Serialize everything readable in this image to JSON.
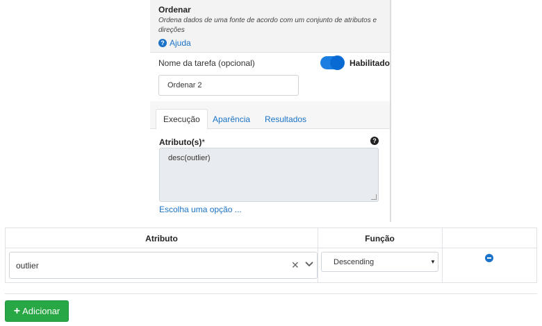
{
  "operation": {
    "title": "Ordenar",
    "description": "Ordena dados de uma fonte de acordo com um conjunto de atributos e direções",
    "help_label": "Ajuda",
    "help_icon": "?"
  },
  "task": {
    "label": "Nome da tarefa (opcional)",
    "value": "Ordenar 2",
    "toggle_label": "Habilitado",
    "toggle_on": true
  },
  "tabs": [
    {
      "label": "Execução",
      "active": true
    },
    {
      "label": "Aparência",
      "active": false
    },
    {
      "label": "Resultados",
      "active": false
    }
  ],
  "attributes_field": {
    "label": "Atributo(s)",
    "required_mark": "*",
    "info_icon": "?",
    "value": "desc(outlier)",
    "choose_link": "Escolha uma opção ..."
  },
  "grid": {
    "headers": {
      "attribute": "Atributo",
      "function": "Função",
      "actions": ""
    },
    "rows": [
      {
        "attribute": "outlier",
        "function": "Descending"
      }
    ]
  },
  "icons": {
    "clear": "✕",
    "caret": "▼",
    "add": "+"
  },
  "actions": {
    "add_label": "Adicionar"
  },
  "colors": {
    "link": "#1a73c8",
    "toggle": "#1a7fe0",
    "add_button": "#28a745"
  }
}
